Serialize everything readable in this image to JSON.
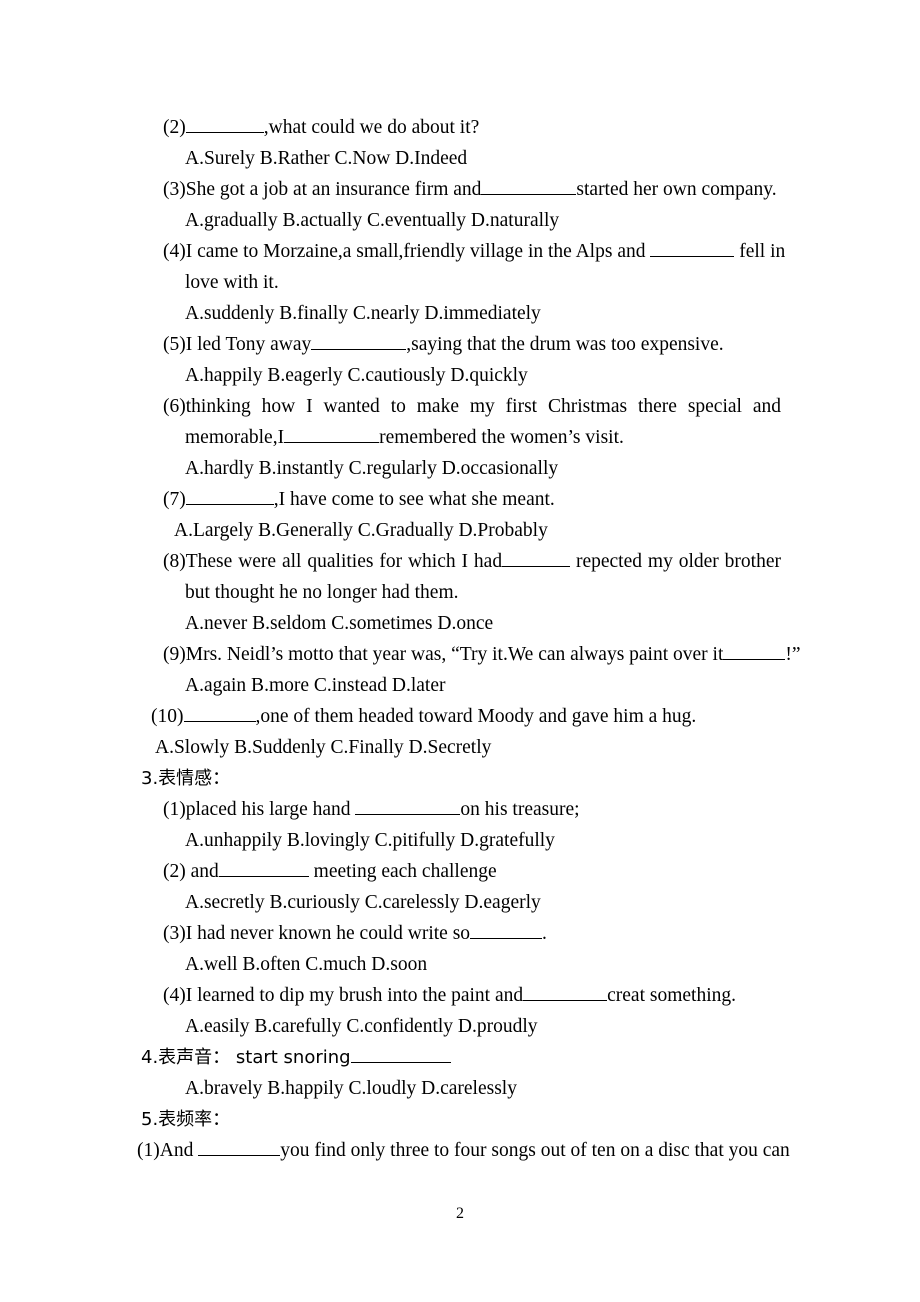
{
  "page": {
    "number": "2",
    "blocks": [
      {
        "kind": "question",
        "style": "plain",
        "id": "q2",
        "pre": "(2)",
        "blank": 78,
        "post": ",what could we do about it?"
      },
      {
        "kind": "options",
        "id": "q2-opts",
        "indent": "opts-a",
        "text": "A.Surely     B.Rather     C.Now       D.Indeed"
      },
      {
        "kind": "question",
        "style": "plain",
        "id": "q3",
        "pre": "(3)She got a job at an insurance firm and",
        "blank": 95,
        "post": "started her own company."
      },
      {
        "kind": "options",
        "id": "q3-opts",
        "indent": "opts-a",
        "text": "A.gradually     B.actually     C.eventually       D.naturally"
      },
      {
        "kind": "question",
        "style": "wrap",
        "id": "q4",
        "pre": "(4)I came to Morzaine,a small,friendly village in the Alps and ",
        "blank": 84,
        "post": " fell in"
      },
      {
        "kind": "continuation",
        "id": "q4-cont",
        "text": "love with it."
      },
      {
        "kind": "options",
        "id": "q4-opts",
        "indent": "opts-a",
        "text": "A.suddenly    B.finally       C.nearly      D.immediately"
      },
      {
        "kind": "question",
        "style": "plain",
        "id": "q5",
        "pre": "(5)I led Tony away",
        "blank": 95,
        "post": ",saying that the drum was too expensive."
      },
      {
        "kind": "options",
        "id": "q5-opts",
        "indent": "opts-a",
        "text": "A.happily     B.eagerly      C.cautiously     D.quickly"
      },
      {
        "kind": "question",
        "style": "justify",
        "id": "q6",
        "pre": "(6)thinking how I wanted to make my first Christmas there special and",
        "blank": 0,
        "post": ""
      },
      {
        "kind": "continuation",
        "id": "q6-cont",
        "pre": "memorable,I",
        "blank": 95,
        "post": "remembered the women’s visit."
      },
      {
        "kind": "options",
        "id": "q6-opts",
        "indent": "opts-a",
        "text": "A.hardly       B.instantly         C.regularly       D.occasionally"
      },
      {
        "kind": "question",
        "style": "plain",
        "id": "q7",
        "pre": "(7)",
        "blank": 88,
        "post": ",I have come to see what she meant."
      },
      {
        "kind": "options",
        "id": "q7-opts",
        "indent": "opts-b",
        "text": "A.Largely     B.Generally     C.Gradually     D.Probably"
      },
      {
        "kind": "question",
        "style": "justify",
        "id": "q8",
        "pre": "(8)These were all qualities for which I had",
        "blank": 68,
        "post": " repected my older brother"
      },
      {
        "kind": "continuation",
        "id": "q8-cont",
        "text": "but thought he no longer had them."
      },
      {
        "kind": "options",
        "id": "q8-opts",
        "indent": "opts-a",
        "text": "A.never     B.seldom      C.sometimes        D.once"
      },
      {
        "kind": "question",
        "style": "plain",
        "id": "q9",
        "pre": "(9)Mrs. Neidl’s motto that year was, “Try it.We can always paint over it",
        "blank": 62,
        "post": "!”"
      },
      {
        "kind": "options",
        "id": "q9-opts",
        "indent": "opts-a",
        "text": "A.again     B.more      C.instead          D.later"
      },
      {
        "kind": "question",
        "style": "plain",
        "id": "q10",
        "extraIndent": 10,
        "pre": "(10)",
        "blank": 72,
        "post": ",one of them headed toward Moody and gave him a hug."
      },
      {
        "kind": "options",
        "id": "q10-opts",
        "indent": "opts-a",
        "extraIndent": 14,
        "text": "A.Slowly     B.Suddenly     C.Finally      D.Secretly"
      },
      {
        "kind": "heading",
        "id": "sec3",
        "text": "3.表情感："
      },
      {
        "kind": "question",
        "style": "plain",
        "id": "s3q1",
        "pre": "(1)placed his large hand ",
        "blank": 105,
        "post": "on his treasure;"
      },
      {
        "kind": "options",
        "id": "s3q1-opts",
        "indent": "opts-a",
        "text": "A.unhappily    B.lovingly      C.pitifully     D.gratefully"
      },
      {
        "kind": "question",
        "style": "plain",
        "id": "s3q2",
        "pre": "(2) and",
        "blank": 90,
        "post": " meeting each challenge"
      },
      {
        "kind": "options",
        "id": "s3q2-opts",
        "indent": "opts-a",
        "text": "A.secretly    B.curiously     C.carelessly       D.eagerly"
      },
      {
        "kind": "question",
        "style": "plain",
        "id": "s3q3",
        "pre": "(3)I had never known he could write so",
        "blank": 72,
        "post": "."
      },
      {
        "kind": "options",
        "id": "s3q3-opts",
        "indent": "opts-a",
        "text": "A.well        B.often        C.much          D.soon"
      },
      {
        "kind": "question",
        "style": "plain",
        "id": "s3q4",
        "pre": "(4)I learned to dip my brush into the paint and",
        "blank": 84,
        "post": "creat something."
      },
      {
        "kind": "options",
        "id": "s3q4-opts",
        "indent": "opts-a",
        "text": "A.easily      B.carefully       C.confidently       D.proudly"
      },
      {
        "kind": "heading-inline",
        "id": "sec4",
        "pre": "4.表声音： start snoring",
        "blank": 100,
        "post": ""
      },
      {
        "kind": "options",
        "id": "sec4-opts",
        "indent": "opts-a",
        "text": "A.bravely      B.happily      C.loudly        D.carelessly"
      },
      {
        "kind": "heading",
        "id": "sec5",
        "text": "5.表频率："
      },
      {
        "kind": "question",
        "style": "plain",
        "id": "s5q1",
        "extraIndent": -4,
        "pre": "(1)And ",
        "blank": 82,
        "post": "you find only three to four songs out of ten on a disc that you can"
      }
    ]
  }
}
